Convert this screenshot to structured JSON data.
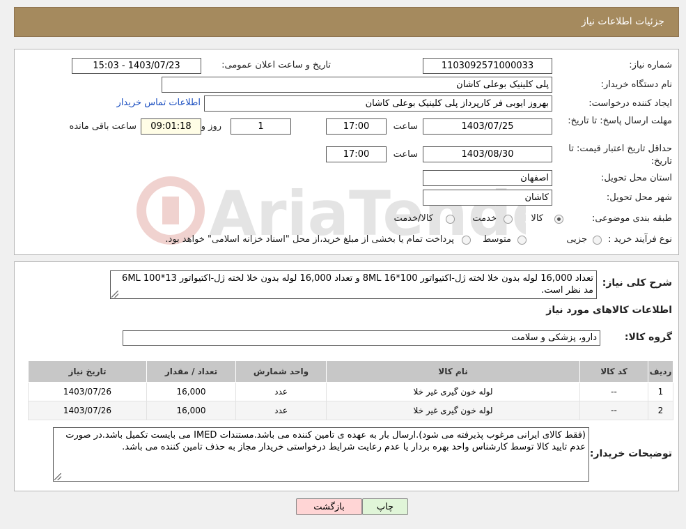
{
  "header": {
    "title": "جزئیات اطلاعات نیاز"
  },
  "form": {
    "need_number": {
      "label": "شماره نیاز:",
      "value": "1103092571000033"
    },
    "announce_date": {
      "label": "تاریخ و ساعت اعلان عمومی:",
      "value": "1403/07/23 - 15:03"
    },
    "buyer_org": {
      "label": "نام دستگاه خریدار:",
      "value": "پلی کلینیک بوعلی کاشان"
    },
    "requester": {
      "label": "ایجاد کننده درخواست:",
      "value": "بهروز ایوبی فر کارپرداز پلی کلینیک بوعلی کاشان",
      "link": "اطلاعات تماس خریدار"
    },
    "reply_deadline": {
      "label": "مهلت ارسال پاسخ: تا تاریخ:",
      "date": "1403/07/25",
      "time_label": "ساعت",
      "time": "17:00",
      "days": "1",
      "days_label": "روز و",
      "remaining": "09:01:18",
      "remaining_label": "ساعت باقی مانده"
    },
    "price_validity": {
      "label": "حداقل تاریخ اعتبار قیمت: تا تاریخ:",
      "date": "1403/08/30",
      "time_label": "ساعت",
      "time": "17:00"
    },
    "province": {
      "label": "استان محل تحویل:",
      "value": "اصفهان"
    },
    "city": {
      "label": "شهر محل تحویل:",
      "value": "کاشان"
    },
    "category": {
      "label": "طبقه بندی موضوعی:",
      "options": [
        "کالا",
        "خدمت",
        "کالا/خدمت"
      ],
      "selected": "کالا"
    },
    "purchase_type": {
      "label": "نوع فرآیند خرید :",
      "options": [
        "جزیی",
        "متوسط"
      ],
      "note": "پرداخت تمام یا بخشی از مبلغ خرید،از محل \"اسناد خزانه اسلامی\" خواهد بود."
    }
  },
  "description": {
    "label": "شرح کلی نیاز:",
    "text": "تعداد 16,000 لوله بدون خلا لخته ژل-اکتیواتور 100*16 8ML و تعداد 16,000 لوله بدون خلا لخته ژل-اکتیواتور 6ML 100*13 مد نظر است."
  },
  "goods_section_title": "اطلاعات کالاهای مورد نیاز",
  "goods_group": {
    "label": "گروه کالا:",
    "value": "دارو، پزشکی و سلامت"
  },
  "table": {
    "headers": [
      "ردیف",
      "کد کالا",
      "نام کالا",
      "واحد شمارش",
      "تعداد / مقدار",
      "تاریخ نیاز"
    ],
    "rows": [
      [
        "1",
        "--",
        "لوله خون گیری غیر خلا",
        "عدد",
        "16,000",
        "1403/07/26"
      ],
      [
        "2",
        "--",
        "لوله خون گیری غیر خلا",
        "عدد",
        "16,000",
        "1403/07/26"
      ]
    ]
  },
  "buyer_notes": {
    "label": "توضیحات خریدار:",
    "text": "(فقط کالای ایرانی مرغوب پذیرفته می شود).ارسال بار به عهده ی تامین کننده می باشد.مستندات IMED می بایست تکمیل باشد.در صورت عدم تایید کالا توسط کارشناس واحد بهره بردار یا عدم رعایت شرایط درخواستی خریدار مجاز به حذف تامین کننده می باشد."
  },
  "buttons": {
    "print": "چاپ",
    "back": "بازگشت"
  },
  "watermark": "AriaTender.neT",
  "colors": {
    "header": "#a58a5e",
    "link": "#1a4ec0",
    "table_header": "#c7c7c7"
  }
}
